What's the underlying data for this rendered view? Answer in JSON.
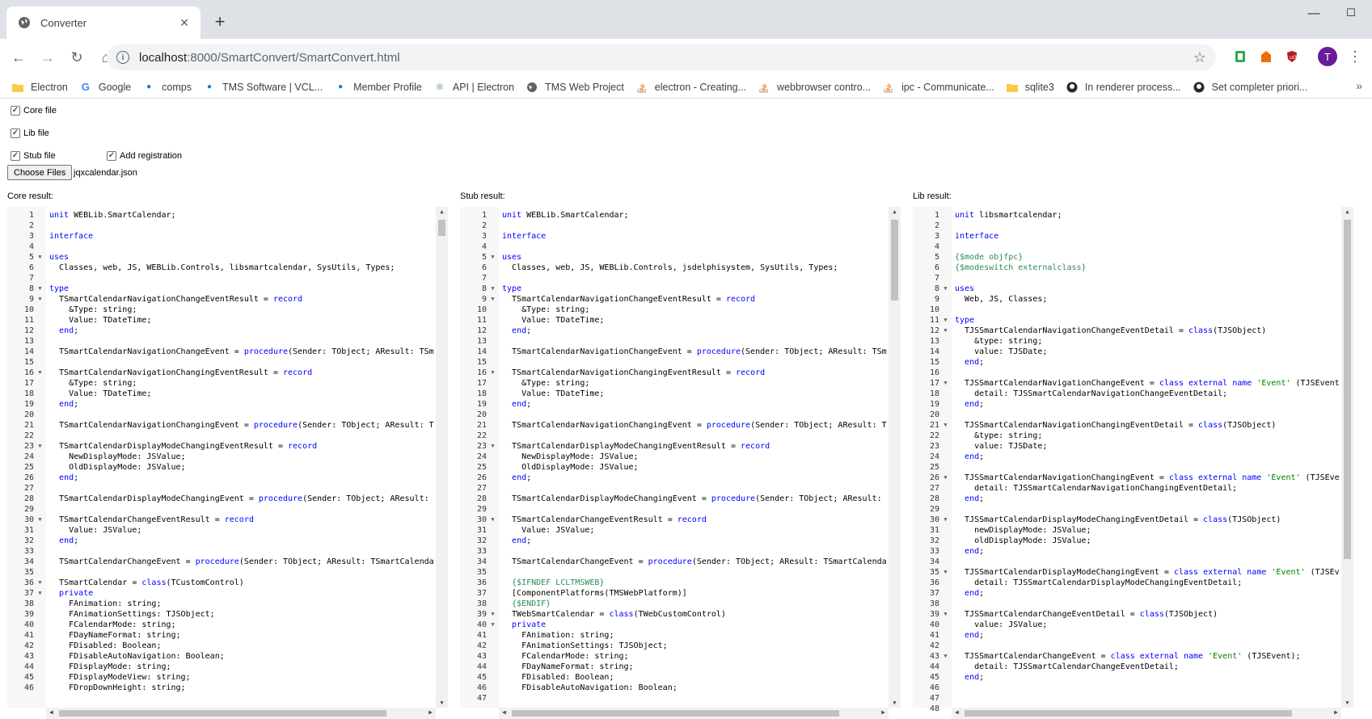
{
  "browser": {
    "tab_title": "Converter",
    "new_tab": "+",
    "url_host": "localhost",
    "url_rest": ":8000/SmartConvert/SmartConvert.html",
    "profile_initial": "T",
    "window_controls": [
      "minimize-icon",
      "maximize-icon",
      "close-icon"
    ]
  },
  "bookmarks": [
    {
      "label": "Electron",
      "icon": "folder-icon"
    },
    {
      "label": "Google",
      "icon": "google-icon"
    },
    {
      "label": "comps",
      "icon": "dot-icon"
    },
    {
      "label": "TMS Software | VCL...",
      "icon": "dot-icon"
    },
    {
      "label": "Member Profile",
      "icon": "dot-icon"
    },
    {
      "label": "API | Electron",
      "icon": "electron-icon"
    },
    {
      "label": "TMS Web Project",
      "icon": "globe-icon"
    },
    {
      "label": "electron - Creating...",
      "icon": "stackoverflow-icon"
    },
    {
      "label": "webbrowser contro...",
      "icon": "stackoverflow-icon"
    },
    {
      "label": "ipc - Communicate...",
      "icon": "stackoverflow-icon"
    },
    {
      "label": "sqlite3",
      "icon": "folder-icon"
    },
    {
      "label": "In renderer process...",
      "icon": "github-icon"
    },
    {
      "label": "Set completer priori...",
      "icon": "github-icon"
    }
  ],
  "options": {
    "core_file": "Core file",
    "lib_file": "Lib file",
    "stub_file": "Stub file",
    "add_registration": "Add registration",
    "choose_files": "Choose Files",
    "file_name": "jqxcalendar.json"
  },
  "panels": {
    "core_label": "Core result:",
    "stub_label": "Stub result:",
    "lib_label": "Lib result:"
  },
  "core_lines": [
    "unit WEBLib.SmartCalendar;",
    "",
    "interface",
    "",
    "uses",
    "  Classes, web, JS, WEBLib.Controls, libsmartcalendar, SysUtils, Types;",
    "",
    "type",
    "  TSmartCalendarNavigationChangeEventResult = record",
    "    &Type: string;",
    "    Value: TDateTime;",
    "  end;",
    "",
    "  TSmartCalendarNavigationChangeEvent = procedure(Sender: TObject; AResult: TSm",
    "",
    "  TSmartCalendarNavigationChangingEventResult = record",
    "    &Type: string;",
    "    Value: TDateTime;",
    "  end;",
    "",
    "  TSmartCalendarNavigationChangingEvent = procedure(Sender: TObject; AResult: T",
    "",
    "  TSmartCalendarDisplayModeChangingEventResult = record",
    "    NewDisplayMode: JSValue;",
    "    OldDisplayMode: JSValue;",
    "  end;",
    "",
    "  TSmartCalendarDisplayModeChangingEvent = procedure(Sender: TObject; AResult: ",
    "",
    "  TSmartCalendarChangeEventResult = record",
    "    Value: JSValue;",
    "  end;",
    "",
    "  TSmartCalendarChangeEvent = procedure(Sender: TObject; AResult: TSmartCalenda",
    "",
    "  TSmartCalendar = class(TCustomControl)",
    "  private",
    "    FAnimation: string;",
    "    FAnimationSettings: TJSObject;",
    "    FCalendarMode: string;",
    "    FDayNameFormat: string;",
    "    FDisabled: Boolean;",
    "    FDisableAutoNavigation: Boolean;",
    "    FDisplayMode: string;",
    "    FDisplayModeView: string;",
    "    FDropDownHeight: string;"
  ],
  "stub_lines": [
    "unit WEBLib.SmartCalendar;",
    "",
    "interface",
    "",
    "uses",
    "  Classes, web, JS, WEBLib.Controls, jsdelphisystem, SysUtils, Types;",
    "",
    "type",
    "  TSmartCalendarNavigationChangeEventResult = record",
    "    &Type: string;",
    "    Value: TDateTime;",
    "  end;",
    "",
    "  TSmartCalendarNavigationChangeEvent = procedure(Sender: TObject; AResult: TSm",
    "",
    "  TSmartCalendarNavigationChangingEventResult = record",
    "    &Type: string;",
    "    Value: TDateTime;",
    "  end;",
    "",
    "  TSmartCalendarNavigationChangingEvent = procedure(Sender: TObject; AResult: T",
    "",
    "  TSmartCalendarDisplayModeChangingEventResult = record",
    "    NewDisplayMode: JSValue;",
    "    OldDisplayMode: JSValue;",
    "  end;",
    "",
    "  TSmartCalendarDisplayModeChangingEvent = procedure(Sender: TObject; AResult: ",
    "",
    "  TSmartCalendarChangeEventResult = record",
    "    Value: JSValue;",
    "  end;",
    "",
    "  TSmartCalendarChangeEvent = procedure(Sender: TObject; AResult: TSmartCalenda",
    "",
    "  {$IFNDEF LCLTMSWEB}",
    "  [ComponentPlatforms(TMSWebPlatform)]",
    "  {$ENDIF}",
    "  TWebSmartCalendar = class(TWebCustomControl)",
    "  private",
    "    FAnimation: string;",
    "    FAnimationSettings: TJSObject;",
    "    FCalendarMode: string;",
    "    FDayNameFormat: string;",
    "    FDisabled: Boolean;",
    "    FDisableAutoNavigation: Boolean;",
    ""
  ],
  "lib_lines": [
    "unit libsmartcalendar;",
    "",
    "interface",
    "",
    "{$mode objfpc}",
    "{$modeswitch externalclass}",
    "",
    "uses",
    "  Web, JS, Classes;",
    "",
    "type",
    "  TJSSmartCalendarNavigationChangeEventDetail = class(TJSObject)",
    "    &type: string;",
    "    value: TJSDate;",
    "  end;",
    "",
    "  TJSSmartCalendarNavigationChangeEvent = class external name 'Event' (TJSEvent",
    "    detail: TJSSmartCalendarNavigationChangeEventDetail;",
    "  end;",
    "",
    "  TJSSmartCalendarNavigationChangingEventDetail = class(TJSObject)",
    "    &type: string;",
    "    value: TJSDate;",
    "  end;",
    "",
    "  TJSSmartCalendarNavigationChangingEvent = class external name 'Event' (TJSEve",
    "    detail: TJSSmartCalendarNavigationChangingEventDetail;",
    "  end;",
    "",
    "  TJSSmartCalendarDisplayModeChangingEventDetail = class(TJSObject)",
    "    newDisplayMode: JSValue;",
    "    oldDisplayMode: JSValue;",
    "  end;",
    "",
    "  TJSSmartCalendarDisplayModeChangingEvent = class external name 'Event' (TJSEv",
    "    detail: TJSSmartCalendarDisplayModeChangingEventDetail;",
    "  end;",
    "",
    "  TJSSmartCalendarChangeEventDetail = class(TJSObject)",
    "    value: JSValue;",
    "  end;",
    "",
    "  TJSSmartCalendarChangeEvent = class external name 'Event' (TJSEvent);",
    "    detail: TJSSmartCalendarChangeEventDetail;",
    "  end;",
    "",
    "",
    ""
  ],
  "colors": {
    "keyword": "#0000ff",
    "directive": "#2e8b57",
    "string": "#008000"
  }
}
